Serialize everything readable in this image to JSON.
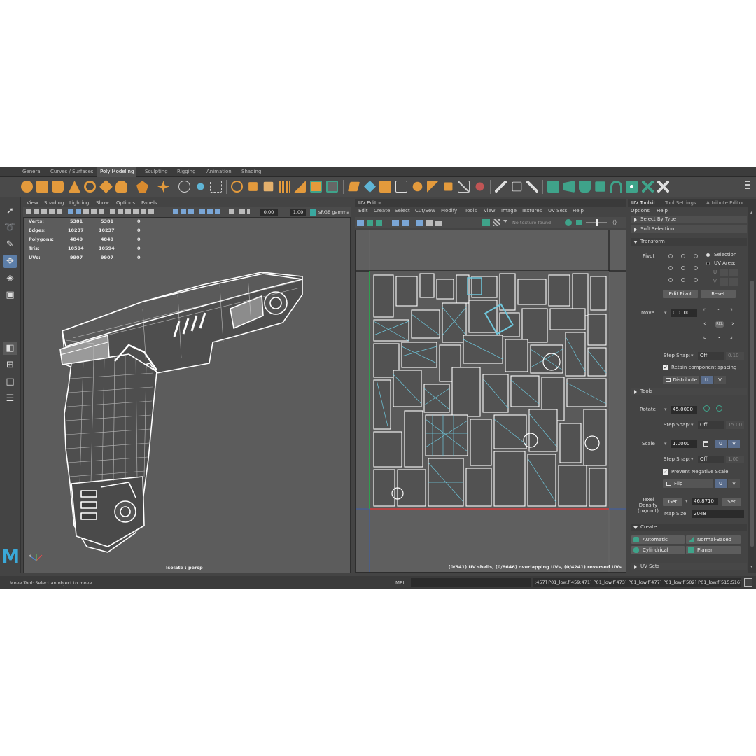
{
  "shelf": {
    "tabs": [
      "General",
      "Curves / Surfaces",
      "Poly Modeling",
      "Sculpting",
      "Rigging",
      "Animation",
      "Shading"
    ],
    "active_tab": "Poly Modeling",
    "accent_color": "#e39a3c",
    "green_color": "#3fa38a"
  },
  "viewport": {
    "menus": [
      "View",
      "Shading",
      "Lighting",
      "Show",
      "Options",
      "Panels"
    ],
    "toolbar": {
      "field1": "0.00",
      "field2": "1.00",
      "color_space": "sRGB gamma"
    },
    "hud": [
      {
        "label": "Verts:",
        "a": "5381",
        "b": "5381",
        "c": "0"
      },
      {
        "label": "Edges:",
        "a": "10237",
        "b": "10237",
        "c": "0"
      },
      {
        "label": "Polygons:",
        "a": "4849",
        "b": "4849",
        "c": "0"
      },
      {
        "label": "Tris:",
        "a": "10594",
        "b": "10594",
        "c": "0"
      },
      {
        "label": "UVs:",
        "a": "9907",
        "b": "9907",
        "c": "0"
      }
    ],
    "camera_label": "Isolate : persp",
    "axis_label": "x"
  },
  "uv_editor": {
    "title": "UV Editor",
    "menus": [
      "Edit",
      "Create",
      "Select",
      "Cut/Sew",
      "Modify",
      "Tools",
      "View",
      "Image",
      "Textures",
      "UV Sets",
      "Help"
    ],
    "texture_label": "No texture found",
    "status": "(0/541) UV shells, (0/8646) overlapping UVs, (0/4241) reversed UVs",
    "shell_color": "#6fc7dc"
  },
  "right_panel": {
    "tabs": [
      "UV Toolkit",
      "Tool Settings",
      "Attribute Editor"
    ],
    "menus": [
      "Options",
      "Help"
    ],
    "sections": {
      "select_by_type": "Select By Type",
      "soft_selection": "Soft Selection",
      "transform": "Transform",
      "tools": "Tools",
      "create": "Create",
      "uv_sets": "UV Sets"
    },
    "pivot": {
      "label": "Pivot",
      "selection": "Selection",
      "uv_area": "UV Area:",
      "u": "U",
      "v": "V",
      "edit_pivot": "Edit Pivot",
      "reset": "Reset"
    },
    "move": {
      "label": "Move",
      "value": "0.0100",
      "center": "REL"
    },
    "step_snap_label": "Step Snap:",
    "step_snap_value": "Off",
    "move_snap_value": "0.10",
    "retain_spacing": "Retain component spacing",
    "distribute": "Distribute",
    "rotate": {
      "label": "Rotate",
      "value": "45.0000",
      "snap_value": "15.00"
    },
    "scale": {
      "label": "Scale",
      "value": "1.0000",
      "snap_value": "1.00"
    },
    "prevent_negative": "Prevent Negative Scale",
    "flip": "Flip",
    "texel": {
      "label": "Texel Density (px/unit)",
      "get": "Get",
      "value": "46.8710",
      "set": "Set",
      "map_size_label": "Map Size:",
      "map_size": "2048"
    },
    "create_buttons": [
      "Automatic",
      "Normal-Based",
      "Cylindrical",
      "Planar"
    ]
  },
  "status": {
    "help_line": "Move Tool: Select an object to move.",
    "mel_label": "MEL",
    "command_output": ":457] P01_low.f[459:471] P01_low.f[473] P01_low.f[477] P01_low.f[502] P01_low.f[515:516]"
  },
  "logo": "M"
}
